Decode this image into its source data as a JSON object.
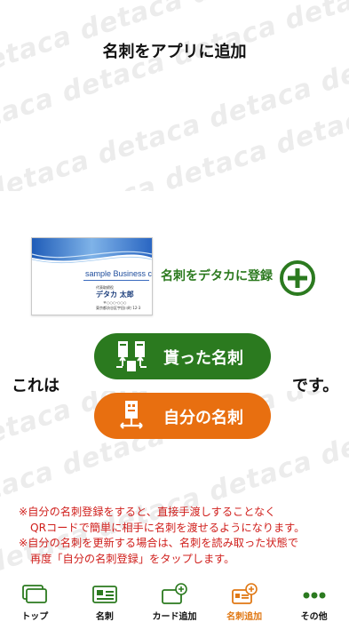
{
  "header": {
    "title": "名刺をアプリに追加"
  },
  "watermark": {
    "text": "detaca"
  },
  "sample_card": {
    "heading": "sample Business card",
    "role": "代表取締役",
    "name": "デタカ 太郎",
    "tel": "〒○○○-○○○",
    "address": "東京都渋谷区宇田川町 12-3"
  },
  "register": {
    "label": "名刺をデタカに登録",
    "icon": "plus-circle-icon"
  },
  "sentence": {
    "prefix": "これは",
    "suffix": "です。"
  },
  "buttons": {
    "received_label": "貰った名刺",
    "received_icon": "card-exchange-icon",
    "received_color": "#2b7a1f",
    "mine_label": "自分の名刺",
    "mine_icon": "card-share-icon",
    "mine_color": "#e86f10"
  },
  "notes": [
    "※自分の名刺登録をすると、直接手渡しすることなく",
    "QRコードで簡単に相手に名刺を渡せるようになります。",
    "※自分の名刺を更新する場合は、名刺を読み取った状態で",
    "再度「自分の名刺登録」をタップします。"
  ],
  "tabbar": {
    "items": [
      {
        "label": "トップ",
        "icon": "cards-stack-icon",
        "active": false
      },
      {
        "label": "名刺",
        "icon": "business-card-icon",
        "active": false
      },
      {
        "label": "カード追加",
        "icon": "card-add-icon",
        "active": false
      },
      {
        "label": "名刺追加",
        "icon": "card-add-orange-icon",
        "active": true
      },
      {
        "label": "その他",
        "icon": "more-dots-icon",
        "active": false
      }
    ],
    "active_color": "#e07814"
  }
}
